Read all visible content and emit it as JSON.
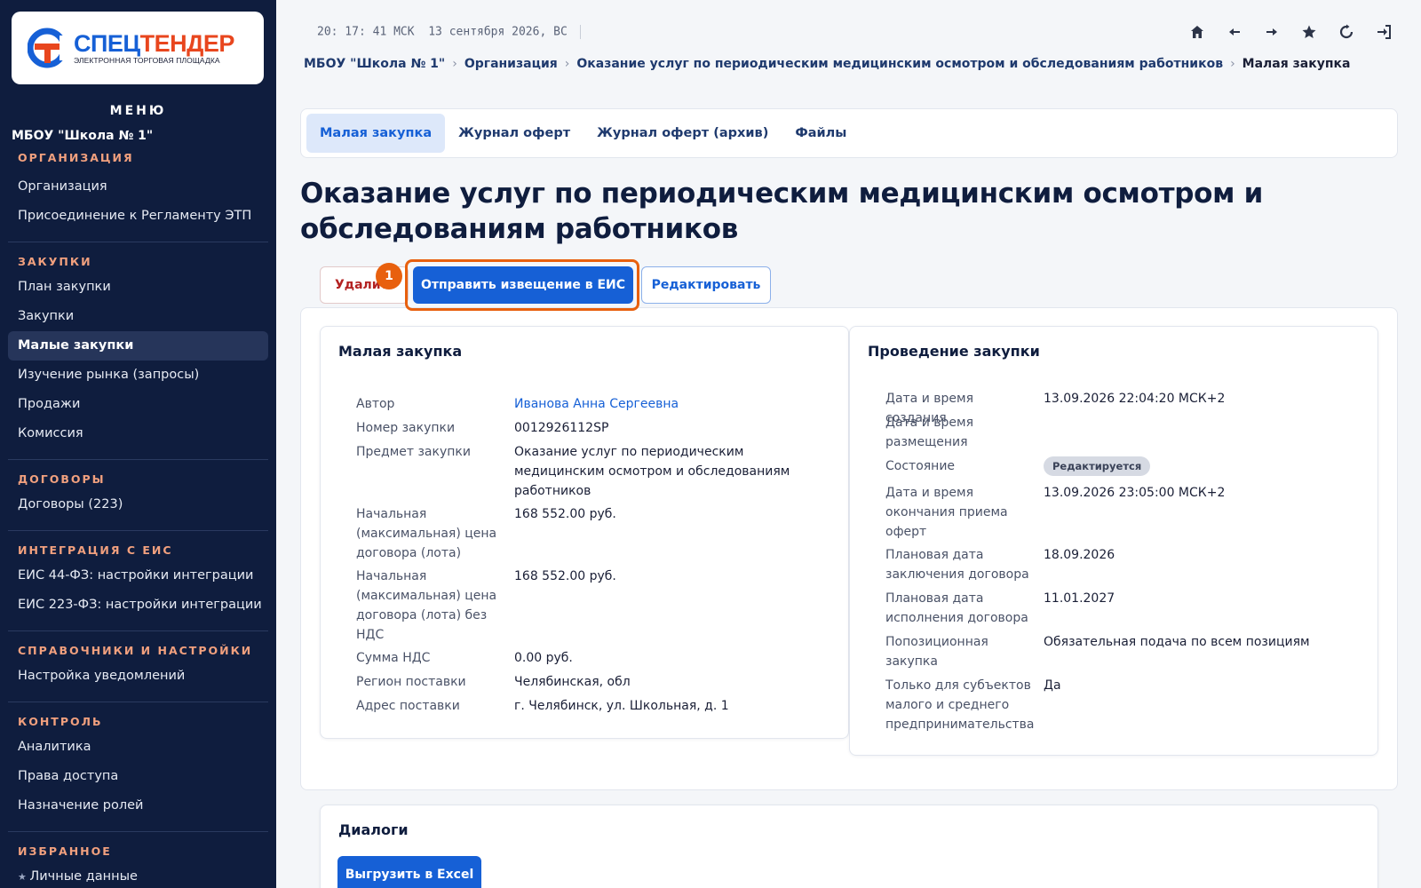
{
  "logo": {
    "brand_part1": "СПЕЦ",
    "brand_part2": "ТЕНДЕР",
    "tagline": "ЭЛЕКТРОННАЯ ТОРГОВАЯ ПЛОЩАДКА",
    "colors": {
      "blue": "#1660d6",
      "orange": "#e8461e"
    }
  },
  "sidebar": {
    "menu_title": "МЕНЮ",
    "org_name": "МБОУ \"Школа № 1\"",
    "sections": [
      {
        "heading": "ОРГАНИЗАЦИЯ",
        "items": [
          "Организация",
          "Присоединение к Регламенту ЭТП"
        ]
      },
      {
        "heading": "ЗАКУПКИ",
        "items": [
          "План закупки",
          "Закупки",
          "Малые закупки",
          "Изучение рынка (запросы)",
          "Продажи",
          "Комиссия"
        ]
      },
      {
        "heading": "ДОГОВОРЫ",
        "items": [
          "Договоры (223)"
        ]
      },
      {
        "heading": "ИНТЕГРАЦИЯ С ЕИС",
        "items": [
          "ЕИС 44-ФЗ: настройки интеграции",
          "ЕИС 223-ФЗ: настройки интеграции"
        ]
      },
      {
        "heading": "СПРАВОЧНИКИ И НАСТРОЙКИ",
        "items": [
          "Настройка уведомлений"
        ]
      },
      {
        "heading": "КОНТРОЛЬ",
        "items": [
          "Аналитика",
          "Права доступа",
          "Назначение ролей"
        ]
      },
      {
        "heading": "ИЗБРАННОЕ",
        "items": [
          "Личные данные"
        ]
      }
    ],
    "active_item": "Малые закупки"
  },
  "topbar": {
    "time": "20: 17: 41 МСК",
    "date": "13 сентября 2026, ВС",
    "icons": [
      "home-icon",
      "arrow-left-icon",
      "arrow-right-icon",
      "star-icon",
      "refresh-icon",
      "logout-icon"
    ]
  },
  "breadcrumb": {
    "items": [
      "МБОУ \"Школа № 1\"",
      "Организация",
      "Оказание услуг по периодическим медицинским осмотром и обследованиям работников"
    ],
    "current": "Малая закупка"
  },
  "tabs": [
    {
      "label": "Малая закупка",
      "active": true
    },
    {
      "label": "Журнал оферт",
      "active": false
    },
    {
      "label": "Журнал оферт (архив)",
      "active": false
    },
    {
      "label": "Файлы",
      "active": false
    }
  ],
  "page_title": "Оказание услуг по периодическим медицинским осмотром и обследованиям работников",
  "actions": {
    "delete_label": "Удалить",
    "send_label": "Отправить извещение в ЕИС",
    "edit_label": "Редактировать",
    "step_number": "1"
  },
  "left_panel": {
    "title": "Малая закупка",
    "rows": [
      {
        "label": "Автор",
        "value": "Иванова Анна Сергеевна",
        "link": true
      },
      {
        "label": "Номер закупки",
        "value": "0012926112SP"
      },
      {
        "label": "Предмет закупки",
        "value": "Оказание услуг по периодическим медицинским осмотром и обследованиям работников"
      },
      {
        "label": "Начальная (максимальная) цена договора (лота)",
        "value": "168 552.00 руб."
      },
      {
        "label": "Начальная (максимальная) цена договора (лота) без НДС",
        "value": "168 552.00 руб."
      },
      {
        "label": "Сумма НДС",
        "value": "0.00 руб."
      },
      {
        "label": "Регион поставки",
        "value": "Челябинская, обл"
      },
      {
        "label": "Адрес поставки",
        "value": "г. Челябинск, ул. Школьная, д. 1"
      }
    ]
  },
  "right_panel": {
    "title": "Проведение закупки",
    "rows": [
      {
        "label": "Дата и время создания",
        "value": "13.09.2026 22:04:20 МСК+2"
      },
      {
        "label": "Дата и время размещения",
        "value": ""
      },
      {
        "label": "Состояние",
        "value": "Редактируется",
        "pill": true
      },
      {
        "label": "Дата и время окончания приема оферт",
        "value": "13.09.2026 23:05:00 МСК+2"
      },
      {
        "label": "Плановая дата заключения договора",
        "value": "18.09.2026"
      },
      {
        "label": "Плановая дата исполнения договора",
        "value": "11.01.2027"
      },
      {
        "label": "Попозиционная закупка",
        "value": "Обязательная подача по всем позициям"
      },
      {
        "label": "Только для субъектов малого и среднего предпринимательства",
        "value": "Да"
      }
    ]
  },
  "dialogs": {
    "title": "Диалоги",
    "excel_label": "Выгрузить в Excel"
  }
}
